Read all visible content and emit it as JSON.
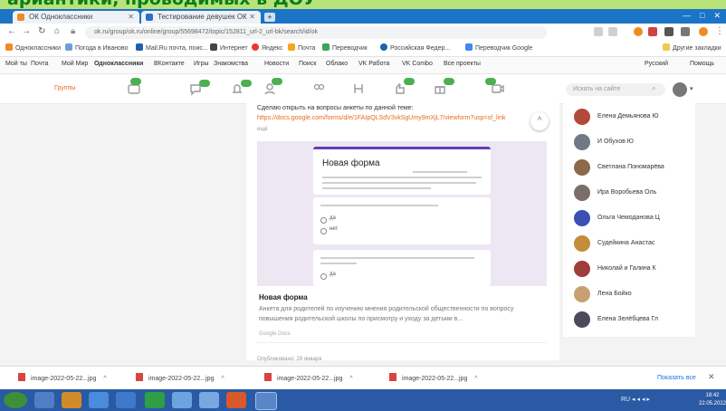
{
  "caption": "ариантики, проводимых в ДОУ",
  "browser": {
    "tabs": [
      {
        "label": "ОК Одноклассники"
      },
      {
        "label": "Тестирование девушек ОК"
      }
    ],
    "new_tab": "+",
    "url": "ok.ru/group/ok.ru/online/group/55698472/topic/152811_url-2_url-bk/search/id/ok",
    "window_controls": [
      "—",
      "□",
      "✕"
    ]
  },
  "bookmarks": [
    "Одноклассники",
    "Погода в Иваново",
    "Mail.Ru почта, поис...",
    "Интернет",
    "Яндекс",
    "Почта",
    "Переводчик",
    "Российская Федер...",
    "Переводчик Google",
    "Другие закладки"
  ],
  "ok_toolbar": {
    "links": [
      "Мой ты",
      "Почта",
      "Мой Мир",
      "Одноклассники",
      "ВКонтакте",
      "Игры",
      "Знакомства",
      "Новости",
      "Поиск",
      "Облако",
      "VK Работа",
      "VK Combo",
      "Все проекты"
    ],
    "right": [
      "Русский",
      "Помощь"
    ]
  },
  "header": {
    "left_label": "Группы",
    "badges": [
      "99",
      "9",
      "14",
      "2",
      "1",
      "9",
      "5",
      "5"
    ],
    "search_placeholder": "Искать на сайте"
  },
  "post": {
    "text": "Сделаю открыть на вопросы анкеты по данной теме:",
    "link": "https://docs.google.com/forms/d/e/1FAIpQLSdV3vkSgUmy9mXjL7/viewform?usp=sf_link",
    "more": "ещё",
    "preview": {
      "form_title": "Новая форма",
      "question1_options": [
        "да",
        "нет"
      ],
      "question2_options": [
        "да"
      ]
    },
    "card_title": "Новая форма",
    "card_description": "Анкета для родителей по изучению мнения родительской общественности по вопросу повышения родительской школы по присмотру и уходу за детьми в...",
    "card_source": "Google Docs",
    "comments_note": "Опубликовано: 29 января"
  },
  "friends": [
    {
      "name": "Елена Демьянова Ю",
      "color": "#b24a3b"
    },
    {
      "name": "И Обухов Ю",
      "color": "#6f7a86"
    },
    {
      "name": "Светлана Пономарёва",
      "color": "#8a6a4a"
    },
    {
      "name": "Ира Воробьева Оль",
      "color": "#7b6e6a"
    },
    {
      "name": "Ольга Чемоданова Ц",
      "color": "#3b4fb5"
    },
    {
      "name": "Судейкина Анастас",
      "color": "#c58c3a"
    },
    {
      "name": "Николай и Галина К",
      "color": "#9f3d3d"
    },
    {
      "name": "Лена Бойко",
      "color": "#c9a06f"
    },
    {
      "name": "Елена Зелёбцева Гл",
      "color": "#4b4b5a"
    }
  ],
  "downloads": {
    "files": [
      "image-2022-05-22...jpg",
      "image-2022-05-22...jpg",
      "image-2022-05-22...jpg",
      "image-2022-05-22...jpg"
    ],
    "show_all": "Показать все",
    "close": "✕"
  },
  "taskbar": {
    "tray": "RU ◂ ◂ ◂ ▸",
    "time": "18:42",
    "date": "22.05.2022"
  }
}
